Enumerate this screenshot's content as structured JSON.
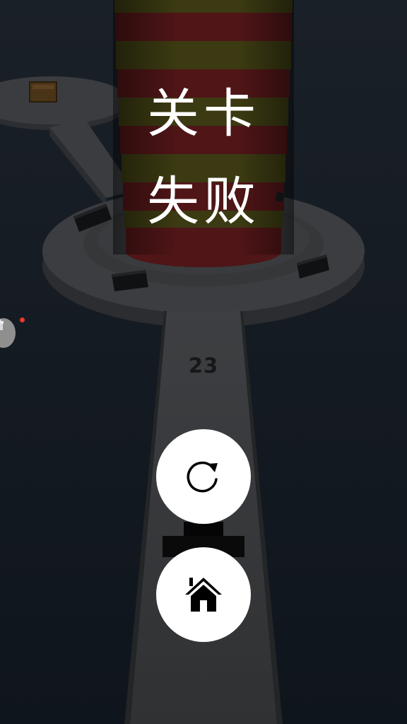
{
  "overlay": {
    "title_line_1": "关卡",
    "title_line_2": "失败"
  },
  "track": {
    "distance_marker": "23"
  },
  "buttons": {
    "restart_icon": "restart-icon",
    "home_icon": "home-icon"
  },
  "side_badge": {
    "icon": "gift-icon",
    "has_notification": true
  },
  "colors": {
    "tower_red": "#4f1517",
    "tower_olive": "#3b3a12",
    "platform": "#3b3d40",
    "background": "#11161d",
    "notification_dot": "#e53b2e"
  }
}
